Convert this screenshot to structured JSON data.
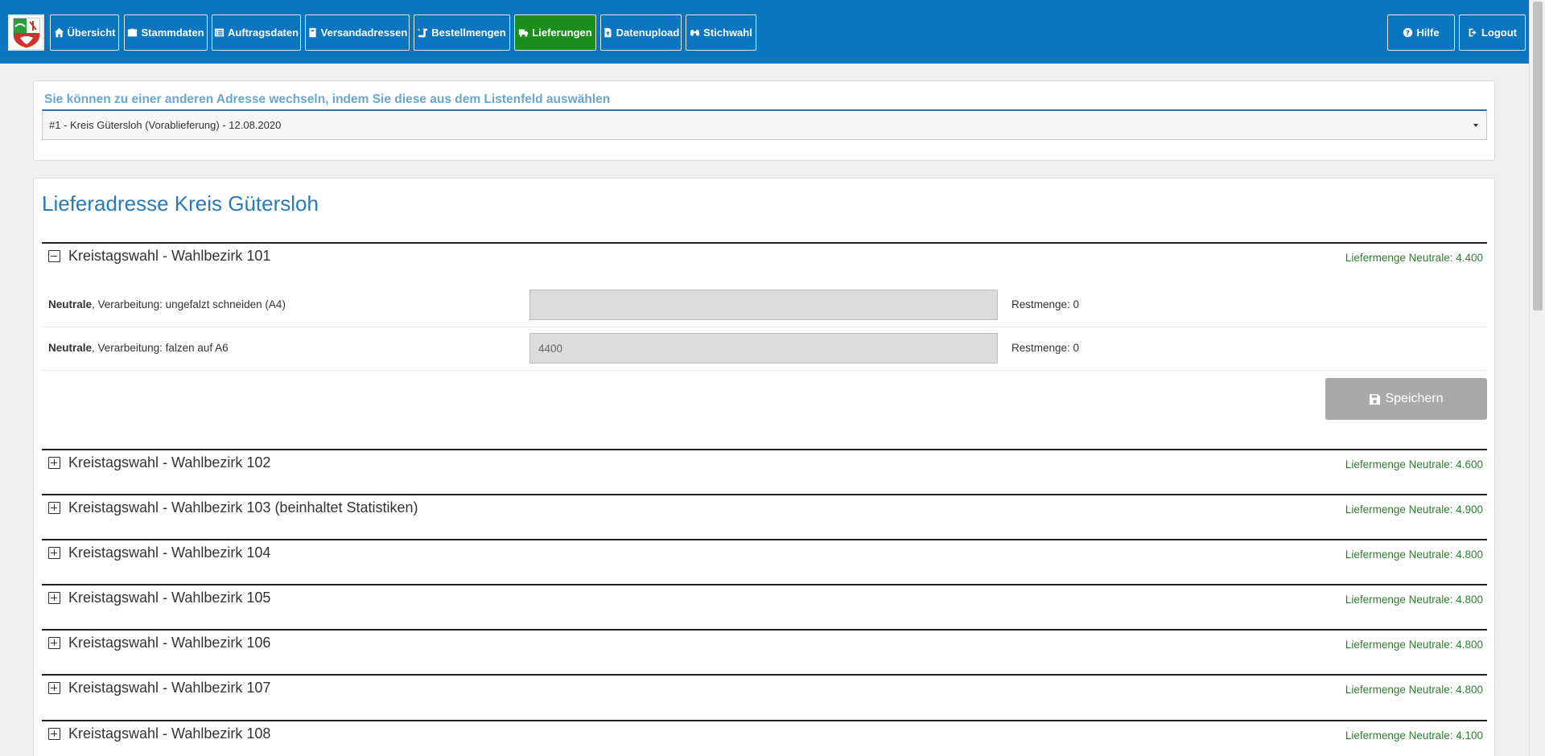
{
  "nav": {
    "items": [
      {
        "label": "Übersicht",
        "icon": "home-icon",
        "active": false
      },
      {
        "label": "Stammdaten",
        "icon": "briefcase-icon",
        "active": false
      },
      {
        "label": "Auftragsdaten",
        "icon": "list-icon",
        "active": false
      },
      {
        "label": "Versandadressen",
        "icon": "address-card-icon",
        "active": false
      },
      {
        "label": "Bestellmengen",
        "icon": "scroll-icon",
        "active": false
      },
      {
        "label": "Lieferungen",
        "icon": "truck-icon",
        "active": true
      },
      {
        "label": "Datenupload",
        "icon": "file-upload-icon",
        "active": false
      },
      {
        "label": "Stichwahl",
        "icon": "binoculars-icon",
        "active": false
      }
    ],
    "help_label": "Hilfe",
    "logout_label": "Logout"
  },
  "switcher": {
    "label": "Sie können zu einer anderen Adresse wechseln, indem Sie diese aus dem Listenfeld auswählen",
    "selected": "#1 - Kreis Gütersloh (Vorablieferung) - 12.08.2020"
  },
  "main": {
    "title": "Lieferadresse Kreis Gütersloh",
    "expanded": {
      "name": "Kreistagswahl - Wahlbezirk 101",
      "qty": "Liefermenge Neutrale: 4.400",
      "lines": [
        {
          "bold": "Neutrale",
          "rest": ", Verarbeitung: ungefalzt schneiden (A4)",
          "value": "",
          "restmenge": "Restmenge: 0"
        },
        {
          "bold": "Neutrale",
          "rest": ", Verarbeitung: falzen auf A6",
          "value": "4400",
          "restmenge": "Restmenge: 0"
        }
      ],
      "save_label": "Speichern"
    },
    "collapsed": [
      {
        "name": "Kreistagswahl - Wahlbezirk 102",
        "qty": "Liefermenge Neutrale: 4.600"
      },
      {
        "name": "Kreistagswahl - Wahlbezirk 103 (beinhaltet Statistiken)",
        "qty": "Liefermenge Neutrale: 4.900"
      },
      {
        "name": "Kreistagswahl - Wahlbezirk 104",
        "qty": "Liefermenge Neutrale: 4.800"
      },
      {
        "name": "Kreistagswahl - Wahlbezirk 105",
        "qty": "Liefermenge Neutrale: 4.800"
      },
      {
        "name": "Kreistagswahl - Wahlbezirk 106",
        "qty": "Liefermenge Neutrale: 4.800"
      },
      {
        "name": "Kreistagswahl - Wahlbezirk 107",
        "qty": "Liefermenge Neutrale: 4.800"
      },
      {
        "name": "Kreistagswahl - Wahlbezirk 108",
        "qty": "Liefermenge Neutrale: 4.100"
      }
    ]
  },
  "colors": {
    "navbar": "#0b75bf",
    "active_tab": "#1b8e1e",
    "title": "#2a7ab8",
    "qty": "#2e7d32"
  }
}
